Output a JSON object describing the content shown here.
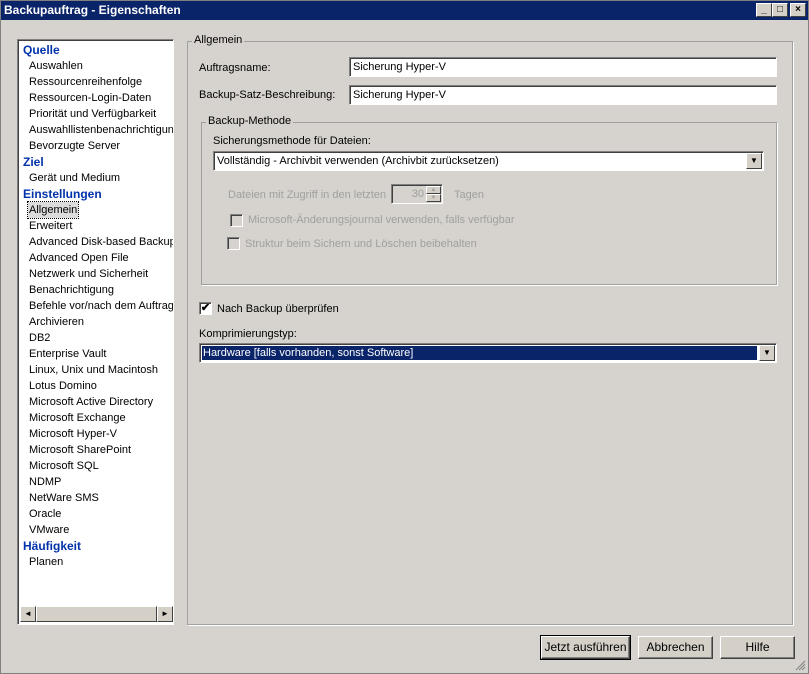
{
  "window": {
    "title": "Backupauftrag - Eigenschaften",
    "minimize": "_",
    "maximize": "□",
    "close": "×"
  },
  "tree": {
    "sections": [
      {
        "heading": "Quelle",
        "items": [
          "Auswahlen",
          "Ressourcenreihenfolge",
          "Ressourcen-Login-Daten",
          "Priorität und Verfügbarkeit",
          "Auswahllistenbenachrichtigung",
          "Bevorzugte Server"
        ]
      },
      {
        "heading": "Ziel",
        "items": [
          "Gerät und Medium"
        ]
      },
      {
        "heading": "Einstellungen",
        "items": [
          "Allgemein",
          "Erweitert",
          "Advanced Disk-based Backup",
          "Advanced Open File",
          "Netzwerk und Sicherheit",
          "Benachrichtigung",
          "Befehle vor/nach dem Auftrag",
          "Archivieren",
          "DB2",
          "Enterprise Vault",
          "Linux, Unix und Macintosh",
          "Lotus Domino",
          "Microsoft Active Directory",
          "Microsoft Exchange",
          "Microsoft Hyper-V",
          "Microsoft SharePoint",
          "Microsoft SQL",
          "NDMP",
          "NetWare SMS",
          "Oracle",
          "VMware"
        ]
      },
      {
        "heading": "Häufigkeit",
        "items": [
          "Planen"
        ]
      }
    ],
    "selected": "Allgemein",
    "scroll_left": "◄",
    "scroll_right": "►"
  },
  "general": {
    "group_label": "Allgemein",
    "job_name_label": "Auftragsname:",
    "job_name_value": "Sicherung Hyper-V",
    "description_label": "Backup-Satz-Beschreibung:",
    "description_value": "Sicherung Hyper-V"
  },
  "backup_method": {
    "group_label": "Backup-Methode",
    "method_label": "Sicherungsmethode für Dateien:",
    "method_value": "Vollständig - Archivbit verwenden (Archivbit zurücksetzen)",
    "days_label": "Dateien mit Zugriff in den letzten",
    "days_value": "30",
    "days_unit": "Tagen",
    "journal_label": "Microsoft-Änderungsjournal verwenden, falls verfügbar",
    "structure_label": "Struktur beim Sichern und Löschen beibehalten"
  },
  "verify": {
    "label": "Nach Backup überprüfen",
    "checked": "✔"
  },
  "compression": {
    "label": "Komprimierungstyp:",
    "value": "Hardware [falls vorhanden, sonst Software]"
  },
  "buttons": {
    "run_now": "Jetzt ausführen",
    "cancel": "Abbrechen",
    "help": "Hilfe"
  },
  "icons": {
    "dropdown": "▼",
    "spin_up": "▲",
    "spin_down": "▼"
  }
}
